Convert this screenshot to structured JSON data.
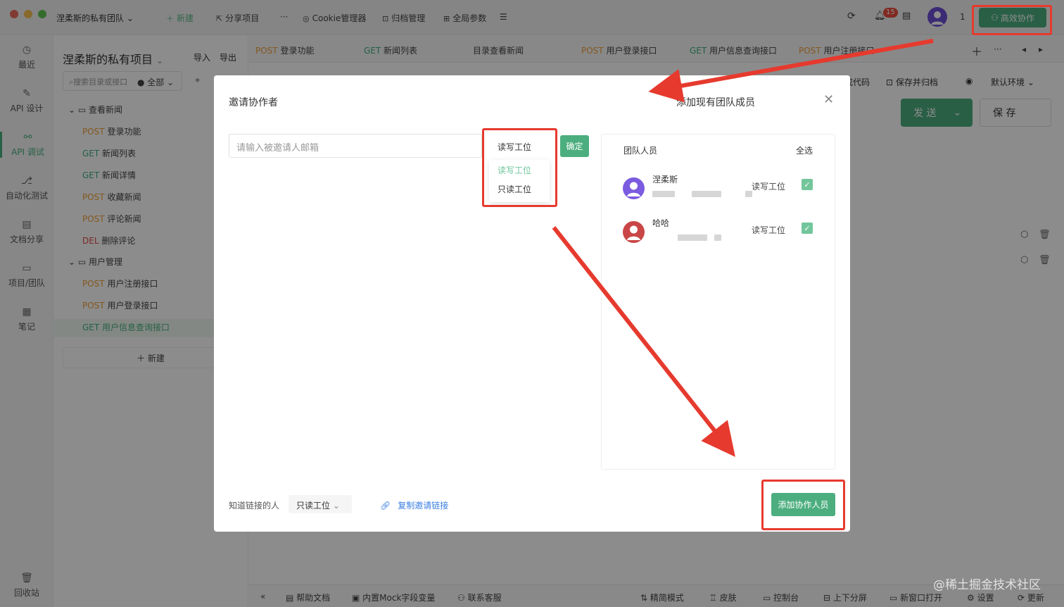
{
  "titlebar": {
    "team_name": "涅柔斯的私有团队",
    "new_label": "新建",
    "share_project": "分享项目",
    "more": "···",
    "cookie_manager": "Cookie管理器",
    "archive_manage": "归档管理",
    "global_params": "全局参数",
    "notification_count": "15",
    "user_count": "1",
    "collab_label": "高效协作"
  },
  "rail": {
    "items": [
      {
        "label": "最近",
        "icon": "clock-icon"
      },
      {
        "label": "API 设计",
        "icon": "edit-icon"
      },
      {
        "label": "API 调试",
        "icon": "link-icon"
      },
      {
        "label": "自动化测试",
        "icon": "flow-icon"
      },
      {
        "label": "文档分享",
        "icon": "doc-icon"
      },
      {
        "label": "项目/团队",
        "icon": "folder-icon"
      },
      {
        "label": "笔记",
        "icon": "note-icon"
      }
    ],
    "trash": "回收站"
  },
  "tree": {
    "project_title": "涅柔斯的私有项目",
    "import": "导入",
    "export": "导出",
    "search_placeholder": "搜索目录或接口",
    "filter": "全部",
    "folders": [
      {
        "name": "查看新闻",
        "items": [
          {
            "method": "POST",
            "name": "登录功能"
          },
          {
            "method": "GET",
            "name": "新闻列表"
          },
          {
            "method": "GET",
            "name": "新闻详情"
          },
          {
            "method": "POST",
            "name": "收藏新闻"
          },
          {
            "method": "POST",
            "name": "评论新闻"
          },
          {
            "method": "DEL",
            "name": "删除评论"
          }
        ]
      },
      {
        "name": "用户管理",
        "items": [
          {
            "method": "POST",
            "name": "用户注册接口"
          },
          {
            "method": "POST",
            "name": "用户登录接口"
          },
          {
            "method": "GET",
            "name": "用户信息查询接口"
          }
        ]
      }
    ],
    "new_label": "新建"
  },
  "tabs": [
    {
      "method": "POST",
      "name": "登录功能"
    },
    {
      "method": "GET",
      "name": "新闻列表"
    },
    {
      "method": "",
      "name": "目录查看新闻"
    },
    {
      "method": "POST",
      "name": "用户登录接口"
    },
    {
      "method": "GET",
      "name": "用户信息查询接口"
    },
    {
      "method": "POST",
      "name": "用户注册接口"
    }
  ],
  "main": {
    "code_label": "成代码",
    "save_archive": "保存并归档",
    "env": "默认环境",
    "send": "发 送",
    "save": "保 存"
  },
  "bottombar": {
    "help": "帮助文档",
    "mock": "内置Mock字段变量",
    "support": "联系客服",
    "simple_mode": "精简模式",
    "skin": "皮肤",
    "console": "控制台",
    "split": "上下分屏",
    "new_window": "新窗口打开",
    "settings": "设置",
    "update": "更新"
  },
  "modal": {
    "title_left": "邀请协作者",
    "title_right": "添加现有团队成员",
    "email_placeholder": "请输入被邀请人邮箱",
    "selected_perm": "读写工位",
    "confirm": "确定",
    "perm_options": [
      "读写工位",
      "只读工位"
    ],
    "members_header": "团队人员",
    "select_all": "全选",
    "members": [
      {
        "name": "涅柔斯",
        "role": "读写工位",
        "checked": true
      },
      {
        "name": "哈哈",
        "role": "读写工位",
        "checked": true
      }
    ],
    "link_label": "知道链接的人",
    "link_perm": "只读工位",
    "copy_link": "复制邀请链接",
    "add_btn": "添加协作人员"
  },
  "watermark": "@稀土掘金技术社区",
  "colors": {
    "accent": "#4cae7e",
    "annotation": "#e63a2e",
    "link": "#3a7ee0"
  }
}
